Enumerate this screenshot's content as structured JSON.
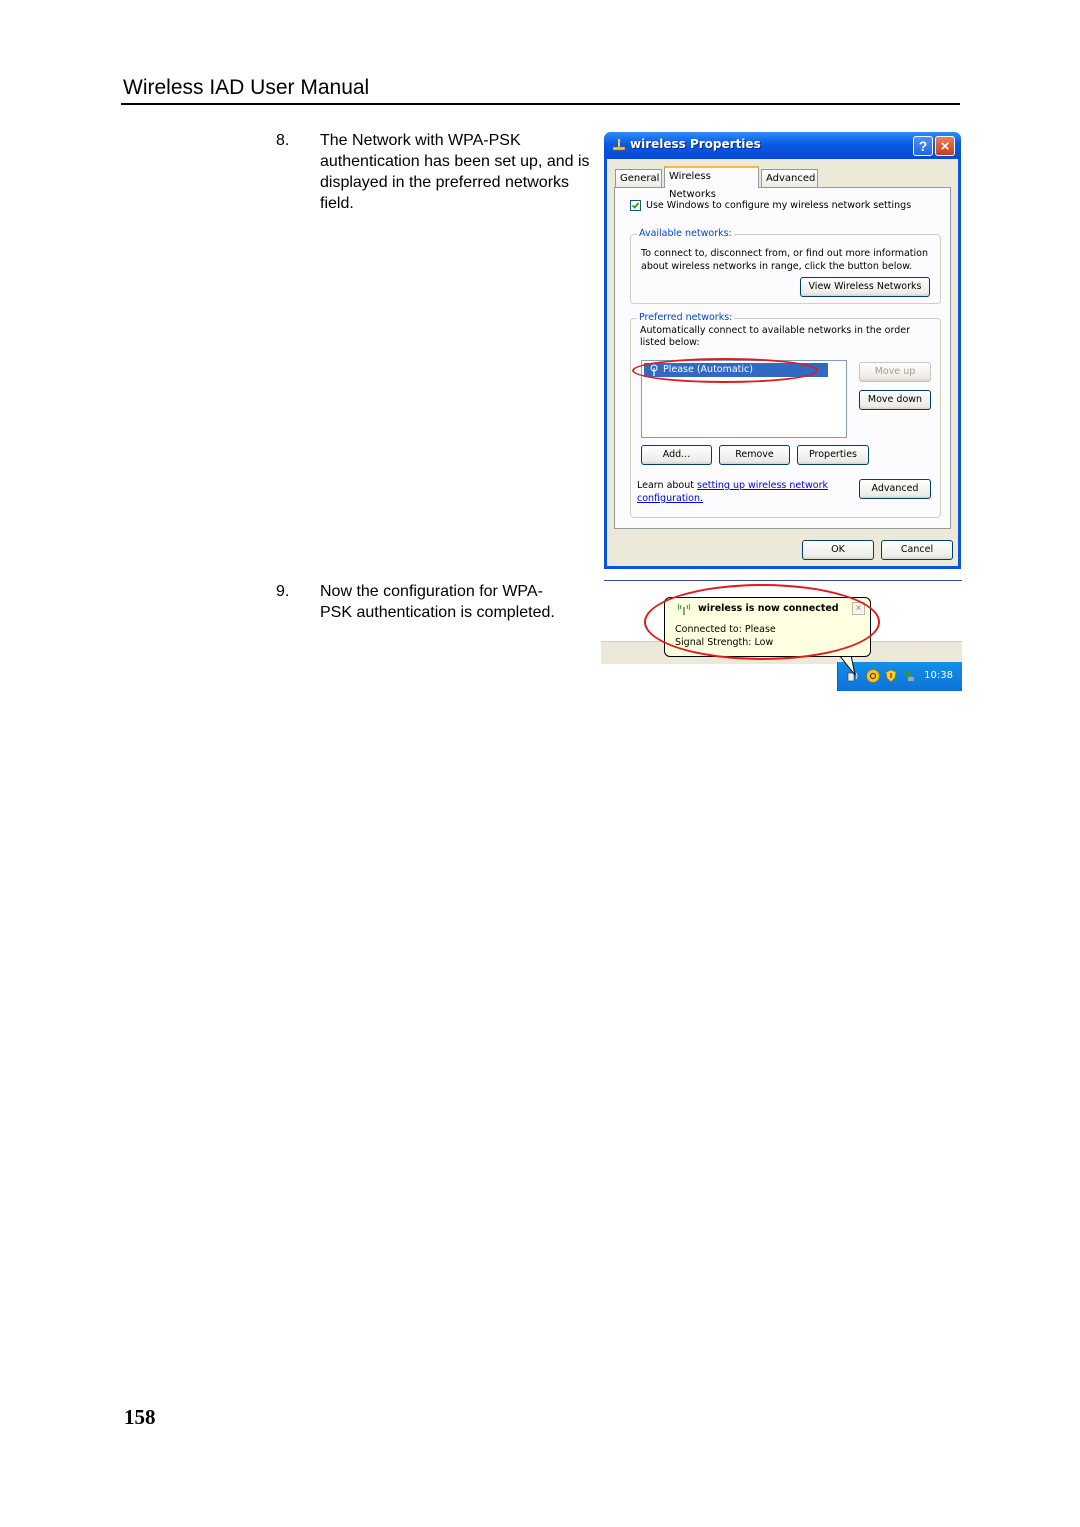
{
  "header": {
    "title": "Wireless IAD User Manual"
  },
  "steps": [
    {
      "number": "8.",
      "text": "The Network with WPA-PSK authentication has been set up, and is displayed in the preferred networks field."
    },
    {
      "number": "9.",
      "text": "Now the configuration for WPA-PSK authentication is completed."
    }
  ],
  "page_number": "158",
  "dialog": {
    "title": "wireless Properties",
    "title_buttons": {
      "help": "?",
      "close": "×"
    },
    "tabs": [
      {
        "label": "General",
        "active": false
      },
      {
        "label": "Wireless Networks",
        "active": true
      },
      {
        "label": "Advanced",
        "active": false
      }
    ],
    "use_windows_checkbox": {
      "label": "Use Windows to configure my wireless network settings",
      "checked": true
    },
    "available": {
      "legend": "Available networks:",
      "description": "To connect to, disconnect from, or find out more information about wireless networks in range, click the button below.",
      "view_button": "View Wireless Networks"
    },
    "preferred": {
      "legend": "Preferred networks:",
      "description": "Automatically connect to available networks in the order listed below:",
      "networks": [
        {
          "label": "Please (Automatic)",
          "selected": true
        }
      ],
      "move_up": "Move up",
      "move_down": "Move down",
      "add": "Add...",
      "remove": "Remove",
      "properties": "Properties",
      "learn_prefix": "Learn about ",
      "learn_link": "setting up wireless network configuration.",
      "advanced": "Advanced"
    },
    "ok": "OK",
    "cancel": "Cancel"
  },
  "notification": {
    "title": "wireless is now connected",
    "line1": "Connected to: Please",
    "line2": "Signal Strength: Low",
    "close": "×",
    "clock": "10:38"
  },
  "colors": {
    "xp_blue": "#0a55e0",
    "highlight": "#316ac5",
    "annotation_red": "#e21a1a",
    "legend_blue": "#0046d5",
    "balloon_bg": "#ffffe1"
  }
}
